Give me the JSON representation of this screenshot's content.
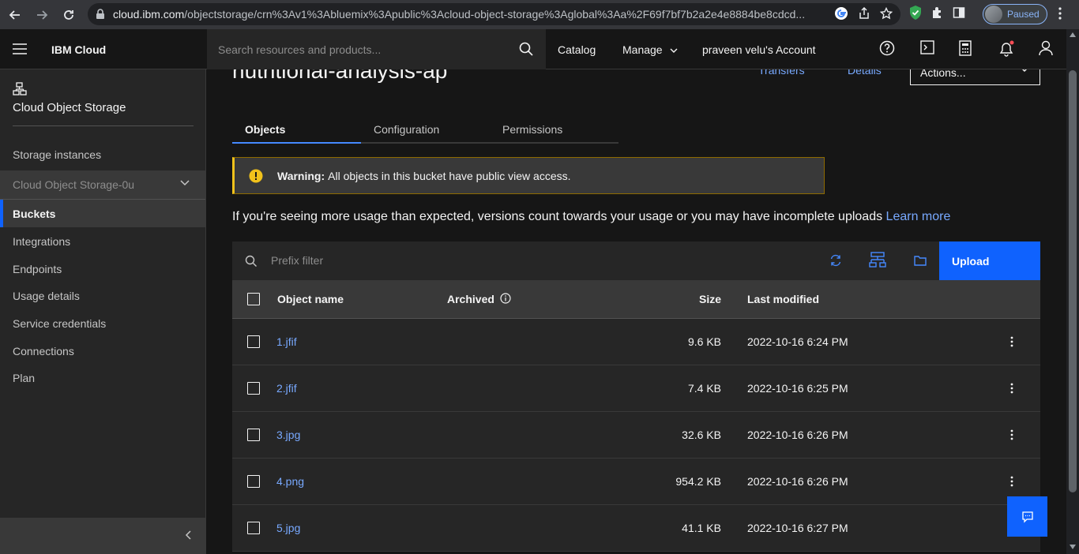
{
  "browser": {
    "url_host": "cloud.ibm.com",
    "url_path": "/objectstorage/crn%3Av1%3Abluemix%3Apublic%3Acloud-object-storage%3Aglobal%3Aa%2F69f7bf7b2a2e4e8884be8cdcd...",
    "profile_status": "Paused"
  },
  "header": {
    "brand": "IBM Cloud",
    "search_placeholder": "Search resources and products...",
    "catalog": "Catalog",
    "manage": "Manage",
    "account": "praveen velu's Account"
  },
  "sidebar": {
    "title": "Cloud Object Storage",
    "items": [
      {
        "label": "Storage instances"
      },
      {
        "label": "Cloud Object Storage-0u"
      },
      {
        "label": "Buckets"
      },
      {
        "label": "Integrations"
      },
      {
        "label": "Endpoints"
      },
      {
        "label": "Usage details"
      },
      {
        "label": "Service credentials"
      },
      {
        "label": "Connections"
      },
      {
        "label": "Plan"
      }
    ]
  },
  "main": {
    "bucket_title": "nutritional-analysis-ap",
    "transfers": "Transfers",
    "details": "Details",
    "actions": "Actions...",
    "tabs": [
      {
        "label": "Objects"
      },
      {
        "label": "Configuration"
      },
      {
        "label": "Permissions"
      }
    ],
    "warning": {
      "title": "Warning:",
      "text": "All objects in this bucket have public view access."
    },
    "usage_note": "If you're seeing more usage than expected, versions count towards your usage or you may have incomplete uploads",
    "learn_more": "Learn more",
    "filter_placeholder": "Prefix filter",
    "upload": "Upload",
    "table": {
      "headers": {
        "name": "Object name",
        "archived": "Archived",
        "size": "Size",
        "modified": "Last modified"
      },
      "rows": [
        {
          "name": "1.jfif",
          "size": "9.6 KB",
          "modified": "2022-10-16 6:24 PM"
        },
        {
          "name": "2.jfif",
          "size": "7.4 KB",
          "modified": "2022-10-16 6:25 PM"
        },
        {
          "name": "3.jpg",
          "size": "32.6 KB",
          "modified": "2022-10-16 6:26 PM"
        },
        {
          "name": "4.png",
          "size": "954.2 KB",
          "modified": "2022-10-16 6:26 PM"
        },
        {
          "name": "5.jpg",
          "size": "41.1 KB",
          "modified": "2022-10-16 6:27 PM"
        }
      ]
    }
  },
  "colors": {
    "accent": "#0f62fe",
    "link": "#78a9ff",
    "warning": "#f1c21b"
  }
}
